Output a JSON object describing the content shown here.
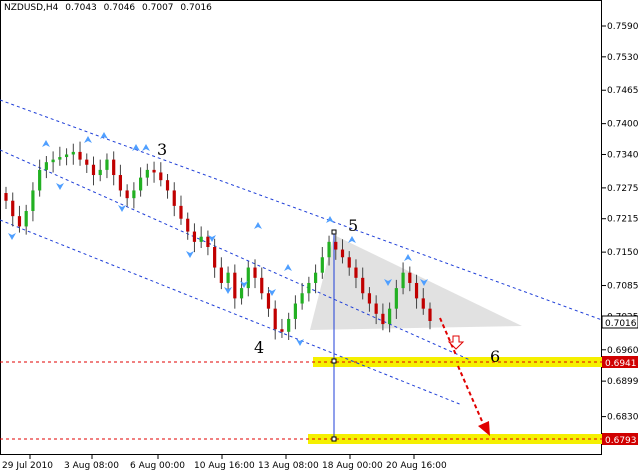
{
  "header": {
    "symbol": "NZDUSD,H4",
    "open": "0.7043",
    "high": "0.7046",
    "low": "0.7007",
    "close": "0.7016"
  },
  "colors": {
    "background": "#ffffff",
    "bull_candle": "#22b022",
    "bear_candle": "#c00000",
    "channel_line": "#1f3fd8",
    "level_line": "#e00000",
    "level_band": "#f5f000",
    "triangle": "#dcdcdc",
    "fractal_arrow": "#4f9fff",
    "forecast_arrow": "#e00000",
    "current_price_label_bg": "#ffffff",
    "level_label_bg": "#d00000"
  },
  "chart_data": {
    "type": "candlestick",
    "title": "NZDUSD,H4",
    "ylim": [
      0.6765,
      0.7625
    ],
    "y_ticks": [
      "0.7590",
      "0.7530",
      "0.7465",
      "0.7400",
      "0.7340",
      "0.7275",
      "0.7215",
      "0.7150",
      "0.7085",
      "0.7025",
      "0.6960",
      "0.6899",
      "0.6830"
    ],
    "x_ticks": [
      "29 Jul 2010",
      "3 Aug 08:00",
      "6 Aug 00:00",
      "10 Aug 16:00",
      "13 Aug 08:00",
      "18 Aug 00:00",
      "20 Aug 16:00"
    ],
    "grid": false,
    "current_price": "0.7016",
    "levels": [
      {
        "label": "0.6941",
        "value": 0.6941
      },
      {
        "label": "0.6793",
        "value": 0.6793
      }
    ],
    "wave_labels": [
      "3",
      "4",
      "5",
      "6"
    ],
    "candles_close_path": [
      0.725,
      0.722,
      0.72,
      0.723,
      0.727,
      0.731,
      0.7325,
      0.733,
      0.7335,
      0.734,
      0.7345,
      0.733,
      0.732,
      0.73,
      0.731,
      0.733,
      0.73,
      0.727,
      0.7255,
      0.727,
      0.7295,
      0.731,
      0.7305,
      0.729,
      0.727,
      0.724,
      0.7215,
      0.719,
      0.717,
      0.718,
      0.716,
      0.712,
      0.709,
      0.711,
      0.706,
      0.708,
      0.712,
      0.71,
      0.707,
      0.704,
      0.7,
      0.6995,
      0.702,
      0.705,
      0.707,
      0.709,
      0.711,
      0.714,
      0.717,
      0.7155,
      0.714,
      0.712,
      0.71,
      0.707,
      0.705,
      0.703,
      0.701,
      0.704,
      0.708,
      0.711,
      0.709,
      0.706,
      0.704,
      0.7016
    ]
  }
}
